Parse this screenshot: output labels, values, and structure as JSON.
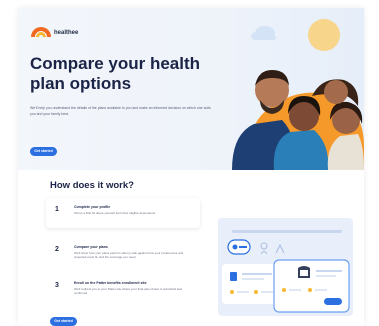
{
  "brand": {
    "name": "healthee",
    "accent": "#2b6fe0",
    "logo_orange": "#f26a1f",
    "logo_yellow": "#f7b731"
  },
  "hero": {
    "title": "Compare your health plan options",
    "subtitle": "We'll help you understand the details of the plans available to you and make an informed decision on which one suits you and your family best.",
    "cta_label": "Get started"
  },
  "how": {
    "title": "How does it work?",
    "steps": [
      {
        "number": "1",
        "title": "Complete your profile",
        "description": "Tell us a little bit about yourself and other eligible dependents."
      },
      {
        "number": "2",
        "title": "Compare your plans",
        "description": "We'll show how your plans perform side by side against how your preferences and projected costs fit, and the coverage you need."
      },
      {
        "number": "3",
        "title": "Enroll on the Patter benefits enrollment site",
        "description": "We'll redirect you to your Patter site where your final plan choice is submitted and confirmed."
      }
    ],
    "cta_label": "Get started"
  },
  "icons": [
    "logo-icon",
    "cloud-icon",
    "family-photo",
    "plan-compare-illustration"
  ]
}
